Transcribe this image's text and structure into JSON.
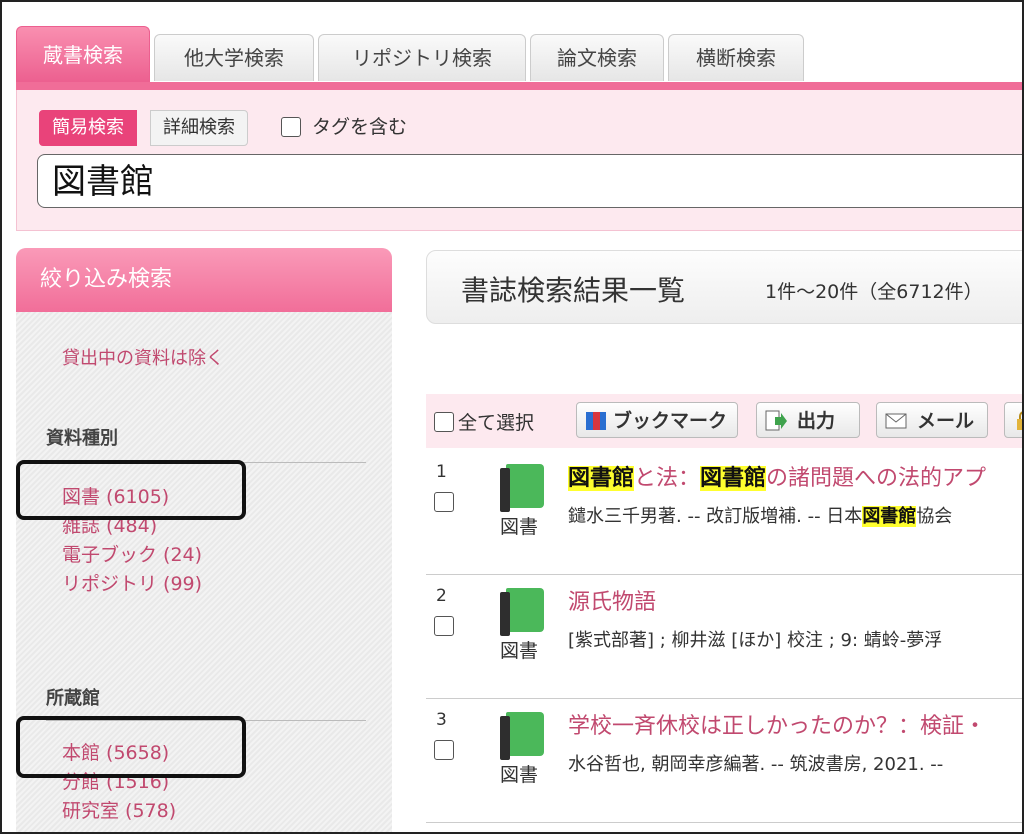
{
  "tabs": [
    "蔵書検索",
    "他大学検索",
    "リポジトリ検索",
    "論文検索",
    "横断検索"
  ],
  "search": {
    "mode_simple": "簡易検索",
    "mode_detail": "詳細検索",
    "tag_label": "タグを含む",
    "query": "図書館"
  },
  "sidebar": {
    "header": "絞り込み検索",
    "exclude": "貸出中の資料は除く",
    "type_title": "資料種別",
    "types": [
      "図書 (6105)",
      "雑誌 (484)",
      "電子ブック (24)",
      "リポジトリ (99)"
    ],
    "location_title": "所蔵館",
    "locations": [
      "本館 (5658)",
      "分館 (1516)",
      "研究室 (578)"
    ]
  },
  "results": {
    "title": "書誌検索結果一覧",
    "count": "1件～20件（全6712件）",
    "select_all": "全て選択",
    "buttons": {
      "bookmark": "ブックマーク",
      "output": "出力",
      "mail": "メール"
    },
    "items": [
      {
        "num": "1",
        "type": "図書",
        "title_parts": [
          "図書館",
          "と法：",
          "図書館",
          "の諸問題への法的アプ"
        ],
        "meta_parts": [
          "鑓水三千男著. -- 改訂版増補. -- 日本",
          "図書館",
          "協会"
        ]
      },
      {
        "num": "2",
        "type": "図書",
        "title": "源氏物語",
        "meta": "[紫式部著] ; 柳井滋 [ほか] 校注 ; 9: 蜻蛉-夢浮"
      },
      {
        "num": "3",
        "type": "図書",
        "title": "学校一斉休校は正しかったのか？：検証・",
        "meta": "水谷哲也, 朝岡幸彦編著. -- 筑波書房, 2021. --"
      }
    ]
  }
}
